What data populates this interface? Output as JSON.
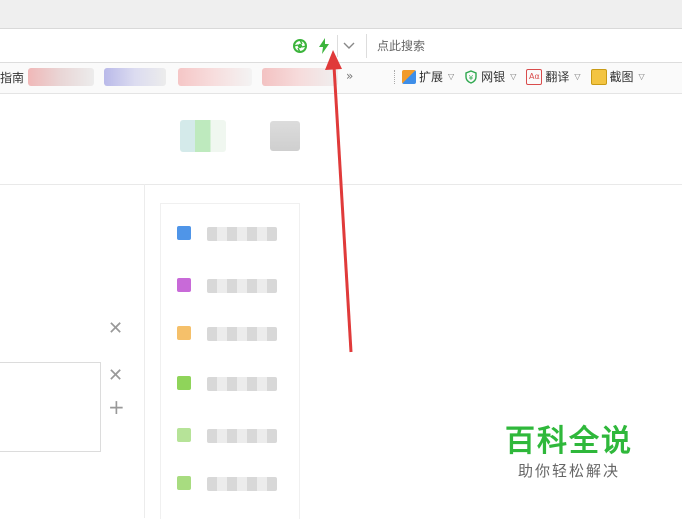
{
  "address_bar": {
    "search_placeholder": "点此搜索",
    "dropdown_glyph": "﹀"
  },
  "bookmarks": {
    "first_label": "指南",
    "more_glyph": "»"
  },
  "tools": [
    {
      "label": "扩展",
      "icon": "extensions-icon"
    },
    {
      "label": "网银",
      "icon": "bank-shield-icon"
    },
    {
      "label": "翻译",
      "icon": "translate-icon"
    },
    {
      "label": "截图",
      "icon": "screenshot-icon"
    }
  ],
  "buttons": {
    "close_glyph": "✕",
    "add_glyph": "+"
  },
  "watermark": {
    "title": "百科全说",
    "subtitle": "助你轻松解决"
  },
  "colors": {
    "arrow": "#e03a3a",
    "watermark_green": "#2fb83b",
    "lightning_green": "#3cb43c"
  }
}
